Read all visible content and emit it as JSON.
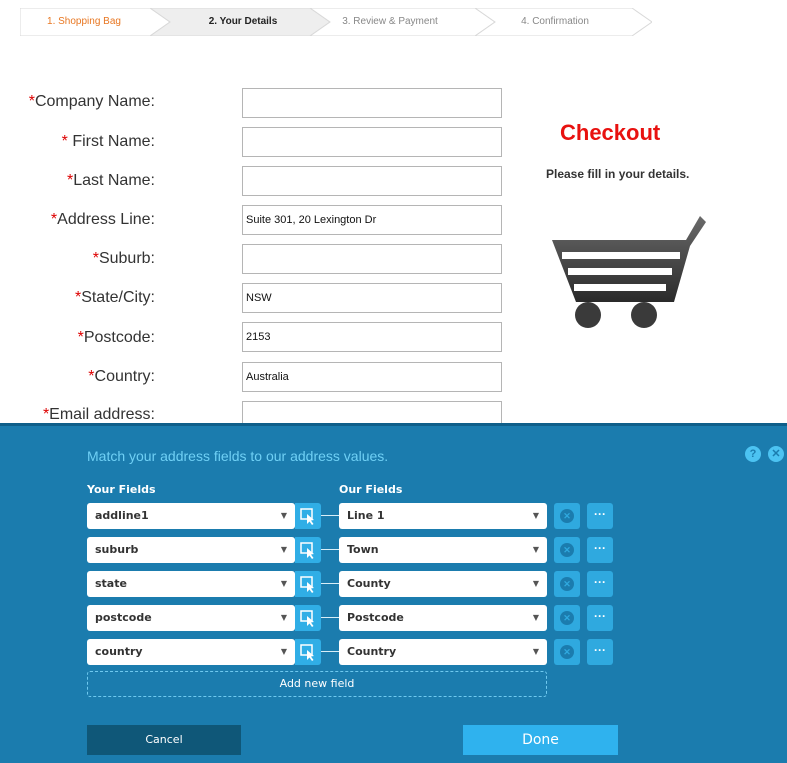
{
  "steps": [
    {
      "label": "1. Shopping Bag"
    },
    {
      "label": "2. Your Details"
    },
    {
      "label": "3. Review & Payment"
    },
    {
      "label": "4. Confirmation"
    }
  ],
  "form": {
    "fields": [
      {
        "label": "Company Name:",
        "value": ""
      },
      {
        "label": "First Name:",
        "value": ""
      },
      {
        "label": "Last Name:",
        "value": ""
      },
      {
        "label": "Address Line:",
        "value": "Suite 301, 20 Lexington Dr"
      },
      {
        "label": "Suburb:",
        "value": ""
      },
      {
        "label": "State/City:",
        "value": "NSW"
      },
      {
        "label": "Postcode:",
        "value": "2153"
      },
      {
        "label": "Country:",
        "value": "Australia"
      },
      {
        "label": "Email address:",
        "value": ""
      }
    ],
    "required_marker": "*"
  },
  "checkout": {
    "title": "Checkout",
    "subtitle": "Please fill in your details."
  },
  "mapper": {
    "title": "Match your address fields to our address values.",
    "help_glyph": "?",
    "close_glyph": "✕",
    "your_fields_header": "Your Fields",
    "our_fields_header": "Our Fields",
    "rows": [
      {
        "your": "addline1",
        "our": "Line 1"
      },
      {
        "your": "suburb",
        "our": "Town"
      },
      {
        "your": "state",
        "our": "County"
      },
      {
        "your": "postcode",
        "our": "Postcode"
      },
      {
        "your": "country",
        "our": "Country"
      }
    ],
    "add_field_label": "Add new field",
    "cancel_label": "Cancel",
    "done_label": "Done",
    "caret_glyph": "▼",
    "delete_glyph": "✕",
    "more_glyph": "···"
  },
  "colors": {
    "accent_orange": "#e87722",
    "required_red": "#dd0000",
    "checkout_red": "#e8110f",
    "panel_blue": "#1b7cae",
    "button_blue": "#2fb2ee"
  }
}
